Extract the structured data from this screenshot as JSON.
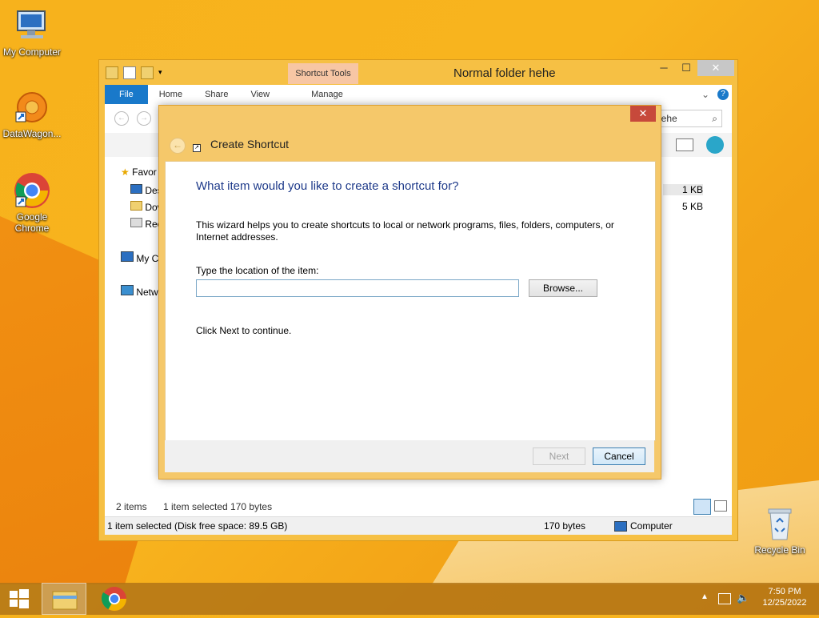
{
  "desktop": {
    "icons": [
      {
        "label": "My Computer",
        "icon": "computer-icon"
      },
      {
        "label": "DataWagon...",
        "icon": "datawagon-icon"
      },
      {
        "label": "Google Chrome",
        "icon": "chrome-icon"
      },
      {
        "label": "Recycle Bin",
        "icon": "recycle-bin-icon"
      }
    ]
  },
  "explorer": {
    "title": "Normal folder  hehe",
    "context_tab": "Shortcut Tools",
    "tabs": [
      "File",
      "Home",
      "Share",
      "View",
      "Manage"
    ],
    "search_partial": "hehe",
    "nav": {
      "favorites": "Favor",
      "items": [
        "Des",
        "Dov",
        "Rec"
      ],
      "my_computer": "My C",
      "network": "Netw"
    },
    "sizes": [
      "1 KB",
      "5 KB"
    ],
    "status_items": "2 items",
    "status_selected": "1 item selected  170 bytes",
    "details_left": "1 item selected (Disk free space: 89.5 GB)",
    "details_size": "170 bytes",
    "details_location": "Computer",
    "minimize": "─",
    "maximize": "☐",
    "close": "✕"
  },
  "dialog": {
    "title": "Create Shortcut",
    "heading": "What item would you like to create a shortcut for?",
    "description": "This wizard helps you to create shortcuts to local or network programs, files, folders, computers, or Internet addresses.",
    "location_label": "Type the location of the item:",
    "location_value": "",
    "browse_label": "Browse...",
    "continue_text": "Click Next to continue.",
    "next_label": "Next",
    "cancel_label": "Cancel",
    "close": "✕"
  },
  "taskbar": {
    "time": "7:50 PM",
    "date": "12/25/2022"
  }
}
